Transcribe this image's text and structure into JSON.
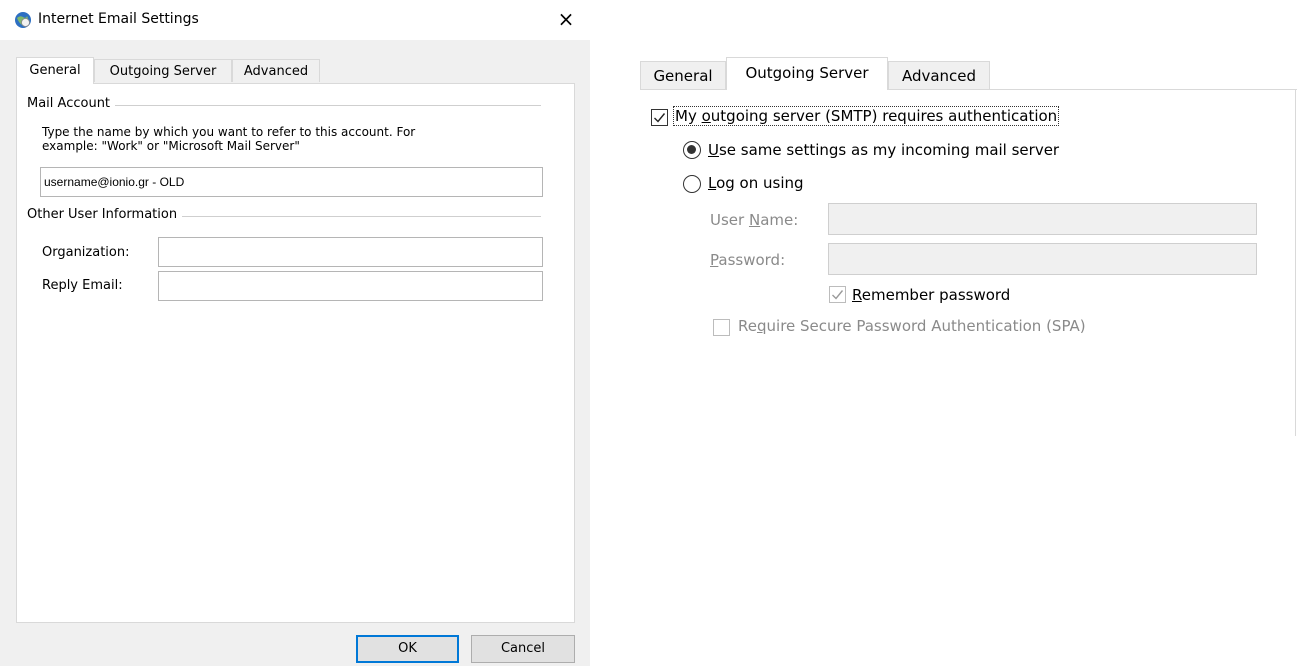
{
  "left_dialog": {
    "title": "Internet Email Settings",
    "close_glyph": "×",
    "tabs": [
      {
        "label": "General",
        "active": true
      },
      {
        "label": "Outgoing Server",
        "active": false
      },
      {
        "label": "Advanced",
        "active": false
      }
    ],
    "mail_account": {
      "group_label": "Mail Account",
      "instruction_line1": "Type the name by which you want to refer to this account. For",
      "instruction_line2": "example: \"Work\" or \"Microsoft Mail Server\"",
      "account_name_value": "username@ionio.gr - OLD"
    },
    "other_user_info": {
      "group_label": "Other User Information",
      "organization_label": "Organization:",
      "organization_value": "",
      "reply_email_label": "Reply Email:",
      "reply_email_value": ""
    },
    "buttons": {
      "ok": "OK",
      "cancel": "Cancel"
    }
  },
  "right_panel": {
    "tabs": [
      {
        "label": "General",
        "active": false
      },
      {
        "label": "Outgoing Server",
        "active": true
      },
      {
        "label": "Advanced",
        "active": false
      }
    ],
    "smtp_auth": {
      "label_pre": "My ",
      "label_accel": "o",
      "label_post": "utgoing server (SMTP) requires authentication",
      "checked": true
    },
    "use_same": {
      "accel": "U",
      "rest": "se same settings as my incoming mail server",
      "selected": true
    },
    "log_on": {
      "accel": "L",
      "rest": "og on using",
      "selected": false
    },
    "user_name": {
      "label_pre": "User ",
      "label_accel": "N",
      "label_post": "ame:",
      "value": ""
    },
    "password": {
      "label_accel": "P",
      "label_post": "assword:",
      "value": ""
    },
    "remember": {
      "accel": "R",
      "rest": "emember password",
      "checked": true
    },
    "spa": {
      "pre": "Re",
      "accel": "q",
      "post": "uire Secure Password Authentication (SPA)",
      "checked": false
    },
    "colors": {
      "focus_button": "#0078d7",
      "disabled_text": "#8a8a8a"
    }
  }
}
